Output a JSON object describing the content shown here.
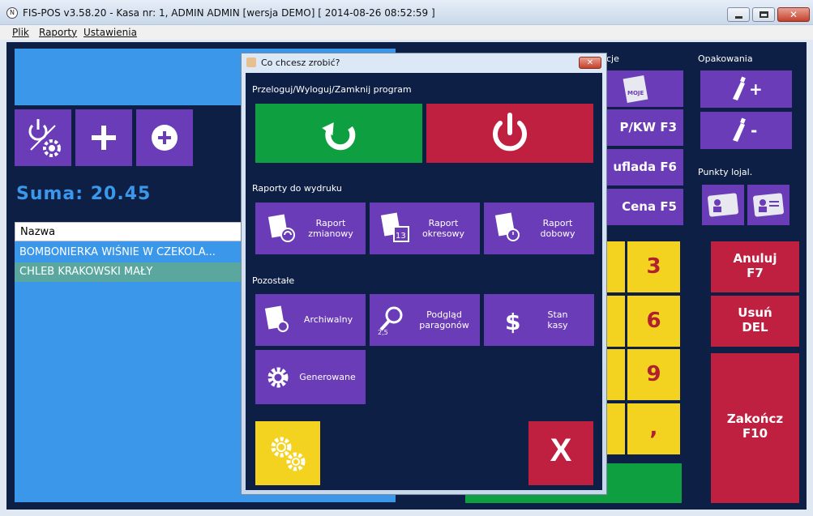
{
  "window": {
    "title": "FIS-POS v3.58.20 - Kasa nr: 1, ADMIN ADMIN [wersja DEMO]  [ 2014-08-26 08:52:59 ]",
    "icon_text": "N",
    "close_symbol": "✕"
  },
  "menu": [
    "Plik",
    "Raporty",
    "Ustawienia"
  ],
  "main": {
    "suma_label": "Suma: 20.45",
    "list_header": "Nazwa",
    "rows": [
      "BOMBONIERKA WIŚNIE W CZEKOLA...",
      "CHLEB KRAKOWSKI MAŁY"
    ]
  },
  "right": {
    "col1_header_fragment": "cje",
    "opakowania_label": "Opakowania",
    "punkty_label": "Punkty lojal.",
    "moje_label": "MOJE",
    "btn_pkw": "P/KW F3",
    "btn_szuflada": "uflada F6",
    "btn_cena": "Cena F5",
    "keys": [
      "3",
      "6",
      "9",
      ","
    ],
    "anuluj": [
      "Anuluj",
      "F7"
    ],
    "usun": [
      "Usuń",
      "DEL"
    ],
    "zakoncz": [
      "Zakończ",
      "F10"
    ],
    "plus_symbol": "+",
    "minus_symbol": "-"
  },
  "dialog": {
    "title": "Co chcesz zrobić?",
    "close_symbol": "✕",
    "section_1": "Przeloguj/Wyloguj/Zamknij program",
    "section_2": "Raporty do wydruku",
    "section_3": "Pozostałe",
    "raport_zmianowy": [
      "Raport",
      "zmianowy"
    ],
    "raport_okresowy": [
      "Raport",
      "okresowy"
    ],
    "raport_dobowy": [
      "Raport",
      "dobowy"
    ],
    "archiwalny": "Archiwalny",
    "podglad": [
      "Podgląd",
      "paragonów"
    ],
    "stan_kasy": [
      "Stan",
      "kasy"
    ],
    "generowane": "Generowane",
    "close_x": "X",
    "okresowy_badge": "13",
    "podglad_digits": "2,5",
    "dollar_symbol": "$"
  },
  "colors": {
    "background": "#0e1f45",
    "purple": "#6a3cb8",
    "blue": "#3a97ea",
    "green": "#0ea040",
    "red": "#c02040",
    "yellow": "#f4d320"
  }
}
